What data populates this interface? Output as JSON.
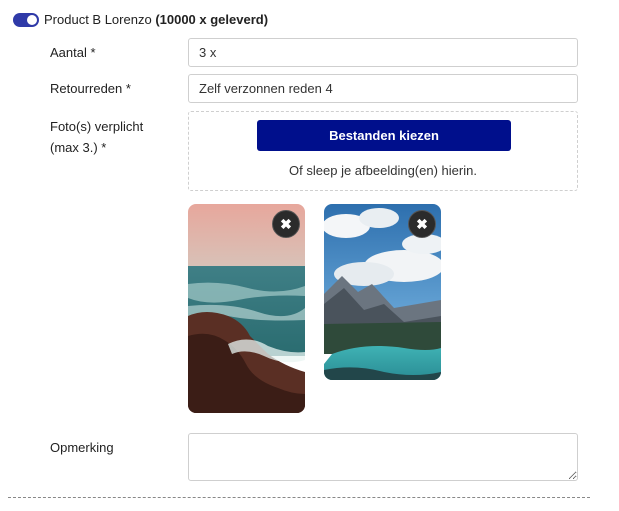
{
  "product": {
    "name": "Product B Lorenzo",
    "delivered": "(10000 x geleverd)",
    "selected": true
  },
  "fields": {
    "quantity": {
      "label": "Aantal *",
      "value": "3 x"
    },
    "reason": {
      "label": "Retourreden *",
      "value": "Zelf verzonnen reden 4"
    },
    "photos": {
      "label_line1": "Foto(s) verplicht",
      "label_line2": "(max 3.) *",
      "choose_label": "Bestanden kiezen",
      "drop_hint": "Of sleep je afbeelding(en) hierin."
    },
    "remark": {
      "label": "Opmerking",
      "value": ""
    }
  },
  "thumbnails": [
    {
      "name": "coast-photo",
      "remove_icon": "close-icon",
      "remove_glyph": "✖"
    },
    {
      "name": "mountain-lake-photo",
      "remove_icon": "close-icon",
      "remove_glyph": "✖"
    }
  ],
  "colors": {
    "toggle": "#2f3aa8",
    "primary_button": "#000f8c"
  }
}
